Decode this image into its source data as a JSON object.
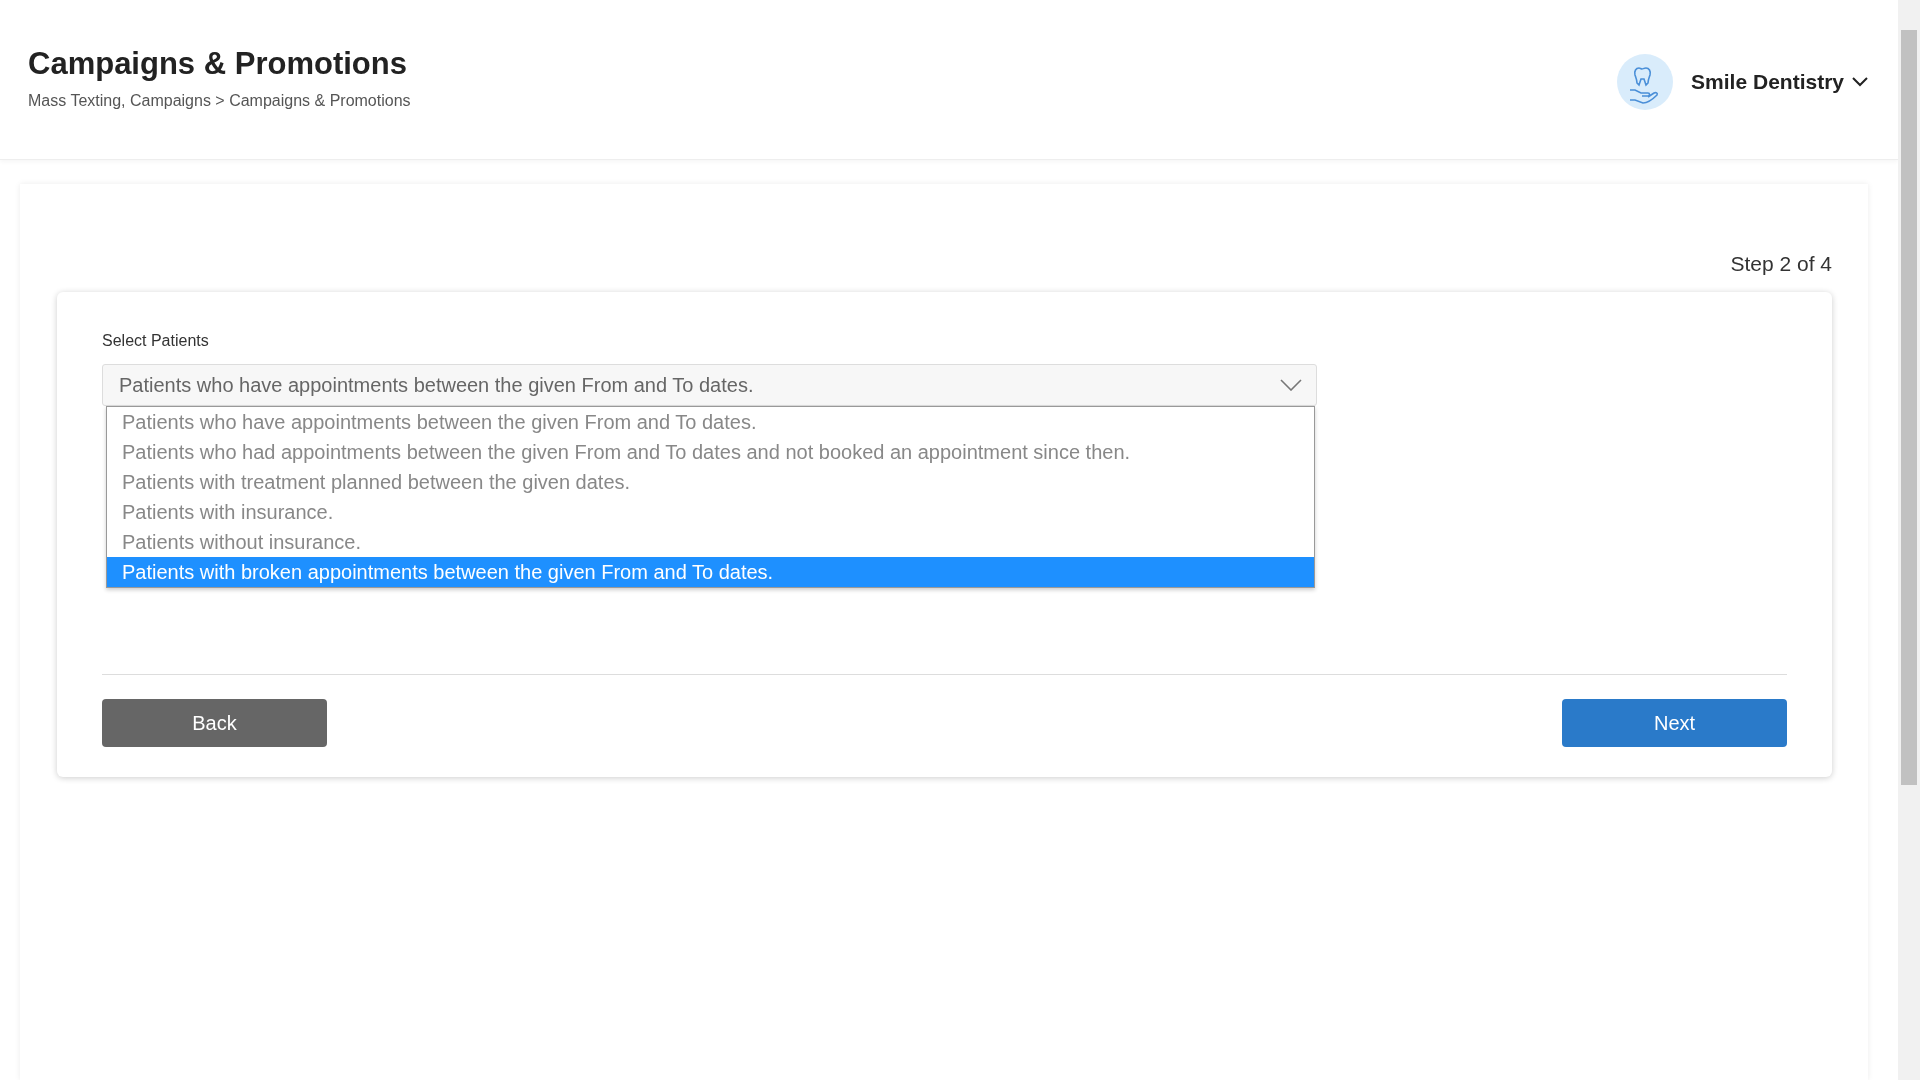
{
  "header": {
    "title": "Campaigns & Promotions",
    "breadcrumb": "Mass Texting, Campaigns > Campaigns & Promotions",
    "practice_name": "Smile Dentistry"
  },
  "step": "Step 2 of 4",
  "select_patients": {
    "label": "Select Patients",
    "value": "Patients who have appointments between the given From and To dates.",
    "expanded": true,
    "options": [
      {
        "label": "Patients who have appointments between the given From and To dates.",
        "highlighted": false
      },
      {
        "label": "Patients who had appointments between the given From and To dates and not booked an appointment since then.",
        "highlighted": false
      },
      {
        "label": "Patients with treatment planned between the given dates.",
        "highlighted": false
      },
      {
        "label": "Patients with insurance.",
        "highlighted": false
      },
      {
        "label": "Patients without insurance.",
        "highlighted": false
      },
      {
        "label": "Patients with broken appointments between the given From and To dates.",
        "highlighted": true
      }
    ]
  },
  "buttons": {
    "back": "Back",
    "next": "Next"
  }
}
